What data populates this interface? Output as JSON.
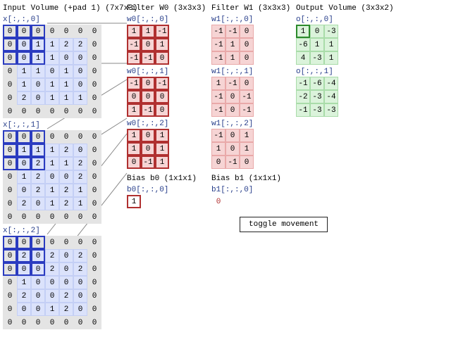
{
  "titles": {
    "input": "Input Volume (+pad 1) (7x7x3)",
    "w0": "Filter W0 (3x3x3)",
    "w1": "Filter W1 (3x3x3)",
    "out": "Output Volume (3x3x2)"
  },
  "labels": {
    "x0": "x[:,:,0]",
    "x1": "x[:,:,1]",
    "x2": "x[:,:,2]",
    "w00": "w0[:,:,0]",
    "w01": "w0[:,:,1]",
    "w02": "w0[:,:,2]",
    "w10": "w1[:,:,0]",
    "w11": "w1[:,:,1]",
    "w12": "w1[:,:,2]",
    "o0": "o[:,:,0]",
    "o1": "o[:,:,1]",
    "b0title": "Bias b0 (1x1x1)",
    "b1title": "Bias b1 (1x1x1)",
    "b0": "b0[:,:,0]",
    "b1": "b1[:,:,0]"
  },
  "toggle": "toggle movement",
  "chart_data": {
    "input": {
      "x0": [
        [
          0,
          0,
          0,
          0,
          0,
          0,
          0
        ],
        [
          0,
          0,
          1,
          1,
          2,
          2,
          0
        ],
        [
          0,
          0,
          1,
          1,
          0,
          0,
          0
        ],
        [
          0,
          1,
          1,
          0,
          1,
          0,
          0
        ],
        [
          0,
          1,
          0,
          1,
          1,
          0,
          0
        ],
        [
          0,
          2,
          0,
          1,
          1,
          1,
          0
        ],
        [
          0,
          0,
          0,
          0,
          0,
          0,
          0
        ]
      ],
      "x1": [
        [
          0,
          0,
          0,
          0,
          0,
          0,
          0
        ],
        [
          0,
          1,
          1,
          1,
          2,
          0,
          0
        ],
        [
          0,
          0,
          2,
          1,
          1,
          2,
          0
        ],
        [
          0,
          1,
          2,
          0,
          0,
          2,
          0
        ],
        [
          0,
          0,
          2,
          1,
          2,
          1,
          0
        ],
        [
          0,
          2,
          0,
          1,
          2,
          1,
          0
        ],
        [
          0,
          0,
          0,
          0,
          0,
          0,
          0
        ]
      ],
      "x2": [
        [
          0,
          0,
          0,
          0,
          0,
          0,
          0
        ],
        [
          0,
          2,
          0,
          2,
          0,
          2,
          0
        ],
        [
          0,
          0,
          0,
          2,
          0,
          2,
          0
        ],
        [
          0,
          1,
          0,
          0,
          0,
          0,
          0
        ],
        [
          0,
          2,
          0,
          0,
          2,
          0,
          0
        ],
        [
          0,
          0,
          0,
          1,
          2,
          0,
          0
        ],
        [
          0,
          0,
          0,
          0,
          0,
          0,
          0
        ]
      ]
    },
    "highlight": {
      "rows": [
        0,
        1,
        2
      ],
      "cols": [
        0,
        1,
        2
      ]
    },
    "W0": {
      "c0": [
        [
          1,
          1,
          -1
        ],
        [
          -1,
          0,
          1
        ],
        [
          -1,
          -1,
          0
        ]
      ],
      "c1": [
        [
          -1,
          0,
          -1
        ],
        [
          0,
          0,
          0
        ],
        [
          1,
          -1,
          0
        ]
      ],
      "c2": [
        [
          1,
          0,
          1
        ],
        [
          1,
          0,
          1
        ],
        [
          0,
          -1,
          1
        ]
      ]
    },
    "W1": {
      "c0": [
        [
          -1,
          -1,
          0
        ],
        [
          -1,
          1,
          0
        ],
        [
          -1,
          1,
          0
        ]
      ],
      "c1": [
        [
          1,
          -1,
          0
        ],
        [
          -1,
          0,
          -1
        ],
        [
          -1,
          0,
          -1
        ]
      ],
      "c2": [
        [
          -1,
          0,
          1
        ],
        [
          1,
          0,
          1
        ],
        [
          0,
          -1,
          0
        ]
      ]
    },
    "bias": {
      "b0": 1,
      "b1": 0
    },
    "output": {
      "o0": [
        [
          1,
          0,
          -3
        ],
        [
          -6,
          1,
          1
        ],
        [
          4,
          -3,
          1
        ]
      ],
      "o1": [
        [
          -1,
          -6,
          -4
        ],
        [
          -2,
          -3,
          -4
        ],
        [
          -1,
          -3,
          -3
        ]
      ]
    },
    "output_highlight": {
      "r": 0,
      "c": 0
    }
  }
}
